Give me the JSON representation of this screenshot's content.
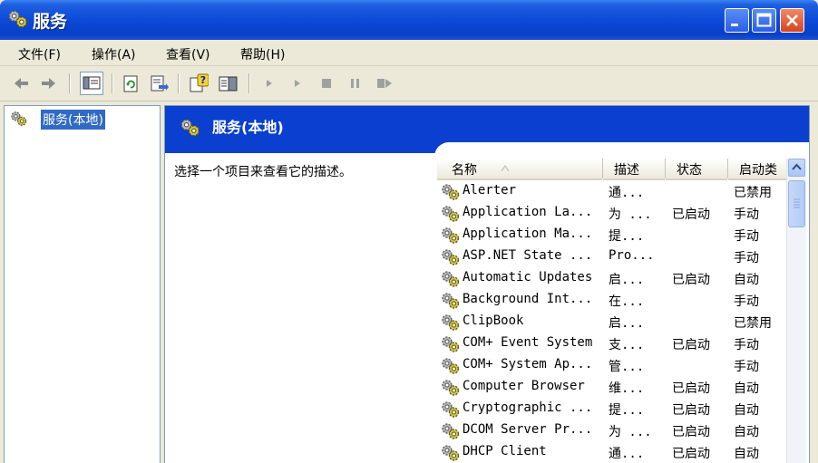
{
  "window": {
    "title": "服务"
  },
  "menu": [
    {
      "label": "文件(F)"
    },
    {
      "label": "操作(A)"
    },
    {
      "label": "查看(V)"
    },
    {
      "label": "帮助(H)"
    }
  ],
  "toolbar": {
    "icons": [
      "back-icon",
      "forward-icon",
      "show-hide-tree-icon",
      "refresh-icon",
      "export-list-icon",
      "help-icon",
      "properties-icon",
      "start-service-icon",
      "start-icon",
      "stop-icon",
      "pause-icon",
      "restart-icon"
    ]
  },
  "tree": {
    "root_label": "服务(本地)"
  },
  "banner": {
    "title": "服务(本地)"
  },
  "description": {
    "text": "选择一个项目来查看它的描述。"
  },
  "list": {
    "columns": [
      {
        "label": "名称"
      },
      {
        "label": "描述"
      },
      {
        "label": "状态"
      },
      {
        "label": "启动类"
      }
    ],
    "rows": [
      {
        "name": "Alerter",
        "desc": "通...",
        "status": "",
        "startup": "已禁用"
      },
      {
        "name": "Application La...",
        "desc": "为 ...",
        "status": "已启动",
        "startup": "手动"
      },
      {
        "name": "Application Ma...",
        "desc": "提...",
        "status": "",
        "startup": "手动"
      },
      {
        "name": "ASP.NET State ...",
        "desc": "Pro...",
        "status": "",
        "startup": "手动"
      },
      {
        "name": "Automatic Updates",
        "desc": "启...",
        "status": "已启动",
        "startup": "自动"
      },
      {
        "name": "Background Int...",
        "desc": "在...",
        "status": "",
        "startup": "手动"
      },
      {
        "name": "ClipBook",
        "desc": "启...",
        "status": "",
        "startup": "已禁用"
      },
      {
        "name": "COM+ Event System",
        "desc": "支...",
        "status": "已启动",
        "startup": "手动"
      },
      {
        "name": "COM+ System Ap...",
        "desc": "管...",
        "status": "",
        "startup": "手动"
      },
      {
        "name": "Computer Browser",
        "desc": "维...",
        "status": "已启动",
        "startup": "自动"
      },
      {
        "name": "Cryptographic ...",
        "desc": "提...",
        "status": "已启动",
        "startup": "自动"
      },
      {
        "name": "DCOM Server Pr...",
        "desc": "为 ...",
        "status": "已启动",
        "startup": "自动"
      },
      {
        "name": "DHCP Client",
        "desc": "通...",
        "status": "已启动",
        "startup": "自动"
      }
    ]
  },
  "colors": {
    "titlebar": "#0a48d6",
    "banner": "#0a3fcf",
    "selection": "#316ac5",
    "chrome": "#ece9d8"
  }
}
